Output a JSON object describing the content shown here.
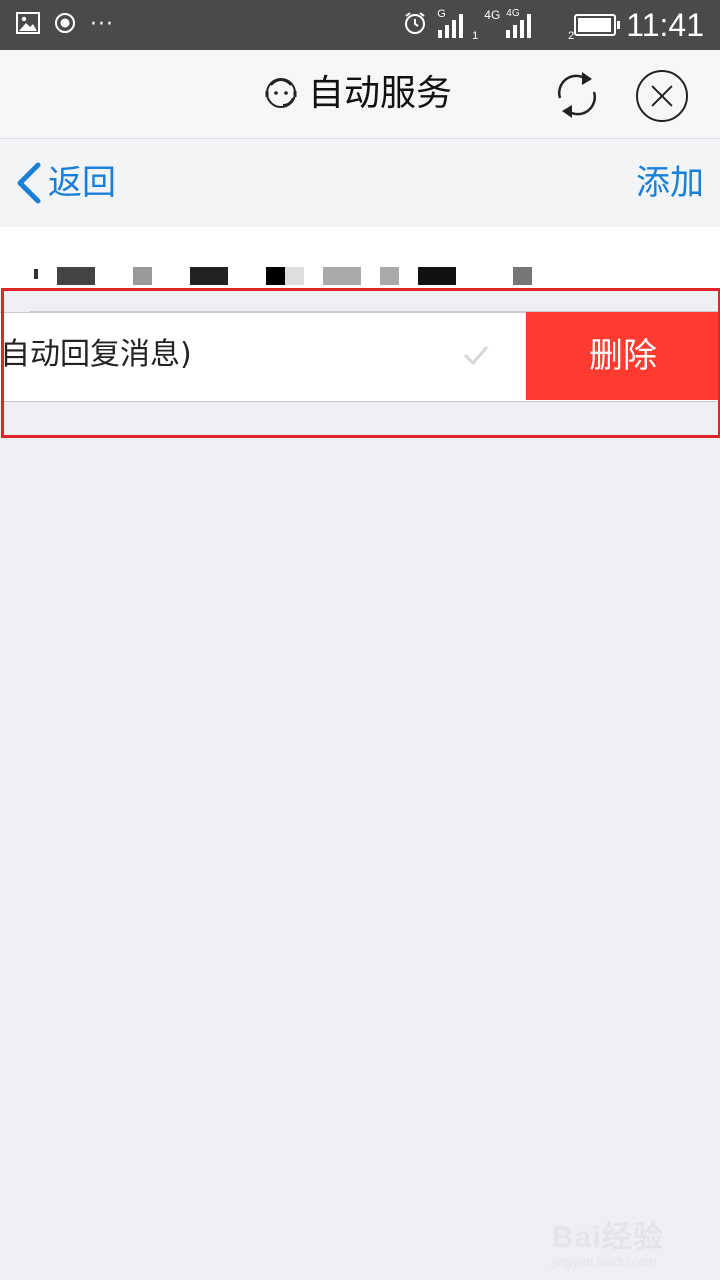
{
  "status_bar": {
    "icons_left": [
      "image-icon",
      "record-icon"
    ],
    "dots": "···",
    "alarm_icon": "alarm-icon",
    "sim1_label": "G",
    "sim1_index": "1",
    "sim2_label": "4G",
    "sim2_label_b": "4G",
    "sim2_index": "2",
    "battery_level": 0.95,
    "time": "11:41"
  },
  "title_bar": {
    "title": "自动服务",
    "avatar_icon": "customer-service-icon",
    "refresh_icon": "refresh-icon",
    "close_icon": "close-icon"
  },
  "nav_bar": {
    "back_label": "返回",
    "add_label": "添加"
  },
  "list": {
    "item_text": "自动回复消息)",
    "delete_label": "删除",
    "checked": true
  },
  "watermark": {
    "main": "Bai经验",
    "sub": "jingyan.baidu.com"
  },
  "colors": {
    "accent_blue": "#1a7fd9",
    "delete_red": "#ff3b30",
    "highlight_red": "#e0242a",
    "status_bar_bg": "#4a4a4a"
  }
}
